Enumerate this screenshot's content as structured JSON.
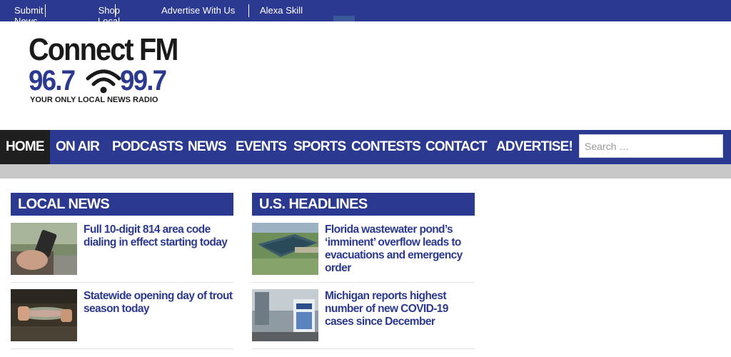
{
  "topbar": {
    "links": [
      "Submit News",
      "Shop Local",
      "Advertise With Us",
      "Alexa Skill"
    ]
  },
  "logo": {
    "brand": "Connect FM",
    "freq_left": "96.7",
    "freq_right": "99.7",
    "tagline": "YOUR ONLY LOCAL NEWS RADIO"
  },
  "nav": {
    "items": [
      "HOME",
      "ON AIR",
      "PODCASTS",
      "NEWS",
      "EVENTS",
      "SPORTS",
      "CONTESTS",
      "CONTACT",
      "ADVERTISE!"
    ],
    "active": "HOME",
    "search_placeholder": "Search …"
  },
  "local_news": {
    "heading": "LOCAL NEWS",
    "stories": [
      {
        "title": "Full 10-digit 814 area code dialing in effect starting today"
      },
      {
        "title": "Statewide opening day of trout season today"
      }
    ]
  },
  "us_headlines": {
    "heading": "U.S. HEADLINES",
    "stories": [
      {
        "title": "Florida wastewater pond’s ‘imminent’ overflow leads to evacuations and emergency order"
      },
      {
        "title": "Michigan reports highest number of new COVID-19 cases since December"
      }
    ]
  },
  "colors": {
    "brand_blue": "#2b3990",
    "active_nav": "#1f1f1f",
    "divider_gray": "#c8c8c8"
  }
}
